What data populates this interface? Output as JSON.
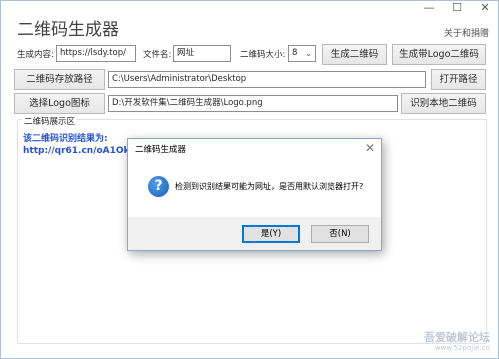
{
  "window": {
    "title": "二维码生成器",
    "about": "关于和捐赠",
    "caption": {
      "minimize": "—",
      "maximize": "☐",
      "close": "✕"
    }
  },
  "form": {
    "content_label": "生成内容:",
    "content_value": "https://lsdy.top/",
    "filename_label": "文件名:",
    "filename_value": "网址",
    "size_label": "二维码大小:",
    "size_value": "8",
    "generate_btn": "生成二维码",
    "generate_logo_btn": "生成带Logo二维码",
    "save_path_btn": "二维码存放路径",
    "save_path_value": "C:\\Users\\Administrator\\Desktop",
    "open_path_btn": "打开路径",
    "logo_btn": "选择Logo图标",
    "logo_path_value": "D:\\开发软件集\\二维码生成器\\Logo.png",
    "recognize_btn": "识别本地二维码"
  },
  "display": {
    "group_title": "二维码展示区",
    "result_line1": "该二维码识别结果为:",
    "result_line2": "http://qr61.cn/oA1OkU/q"
  },
  "dialog": {
    "title": "二维码生成器",
    "message": "检测到识别结果可能为网址，是否用默认浏览器打开?",
    "yes_label": "是(Y)",
    "no_label": "否(N)",
    "icon": "question-icon"
  },
  "watermark": {
    "text": "吾爱破解论坛",
    "url": "www.52pojie.cn"
  }
}
